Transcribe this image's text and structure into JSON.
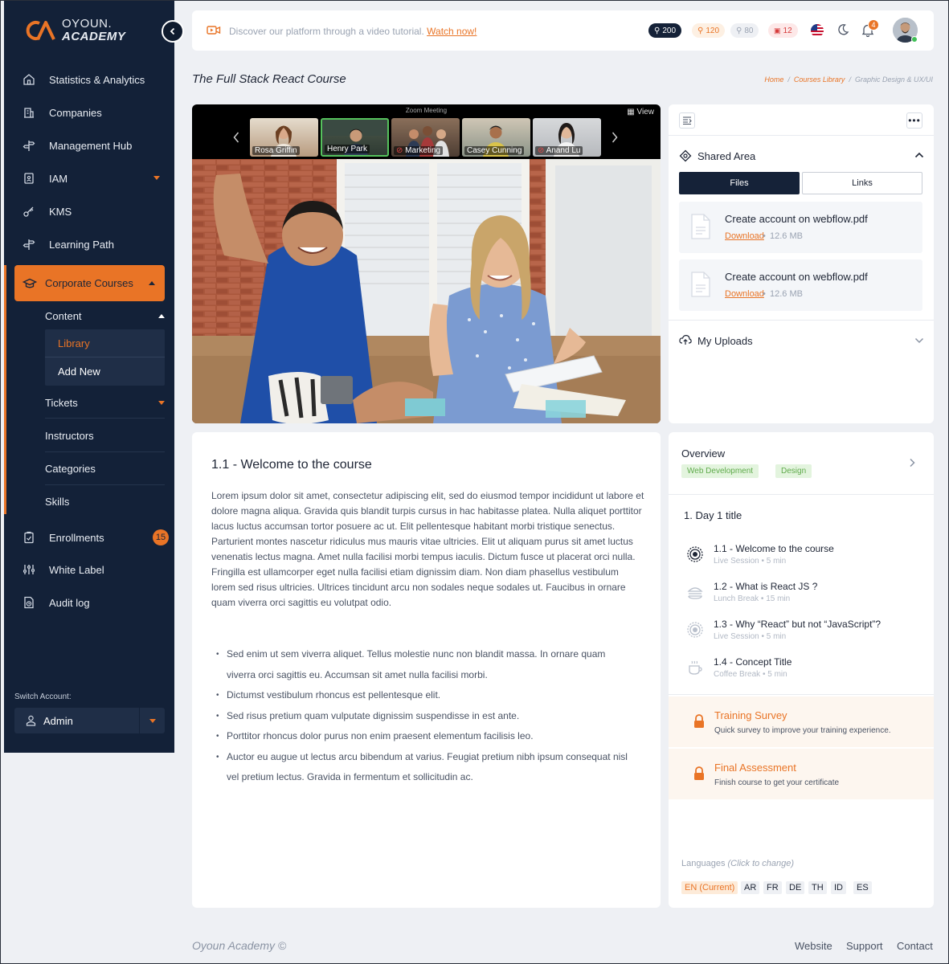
{
  "brand": {
    "line1": "OYOUN.",
    "line2": "ACADEMY"
  },
  "sidebar": {
    "items": [
      {
        "label": "Statistics & Analytics",
        "icon": "home-icon"
      },
      {
        "label": "Companies",
        "icon": "building-icon"
      },
      {
        "label": "Management Hub",
        "icon": "signpost-icon"
      },
      {
        "label": "IAM",
        "icon": "id-badge-icon",
        "has_dropdown": true
      },
      {
        "label": "KMS",
        "icon": "key-icon"
      },
      {
        "label": "Learning Path",
        "icon": "signpost-icon"
      }
    ],
    "active": {
      "label": "Corporate Courses",
      "icon": "graduation-cap-icon"
    },
    "content_group": {
      "label": "Content",
      "children": [
        "Library",
        "Add New"
      ]
    },
    "sub_items": [
      "Tickets",
      "Instructors",
      "Categories",
      "Skills"
    ],
    "bottom_items": [
      {
        "label": "Enrollments",
        "icon": "clipboard-check-icon",
        "badge": "15"
      },
      {
        "label": "White Label",
        "icon": "sliders-icon"
      },
      {
        "label": "Audit log",
        "icon": "file-clock-icon"
      }
    ],
    "switch_label": "Switch Account:",
    "account": "Admin"
  },
  "topbar": {
    "promo_text": "Discover our platform through a video tutorial.",
    "promo_link": "Watch now!",
    "pills": [
      "200",
      "120",
      "80",
      "12"
    ],
    "notification_count": "4"
  },
  "page": {
    "title": "The Full Stack React Course",
    "breadcrumb": [
      "Home",
      "Courses Library",
      "Graphic Design & UX/UI"
    ]
  },
  "video": {
    "meeting_title": "Zoom Meeting",
    "view_label": "View",
    "participants": [
      "Rosa Griffin",
      "Henry Park",
      "Marketing",
      "Casey Cunning",
      "Anand Lu"
    ]
  },
  "shared": {
    "title": "Shared Area",
    "tabs": [
      "Files",
      "Links"
    ],
    "files": [
      {
        "name": "Create account on webflow.pdf",
        "action": "Download",
        "size": "12.6 MB"
      },
      {
        "name": "Create account on webflow.pdf",
        "action": "Download",
        "size": "12.6 MB"
      }
    ],
    "uploads_title": "My Uploads"
  },
  "lesson": {
    "heading": "1.1 - Welcome to the course",
    "paragraph": "Lorem ipsum dolor sit amet, consectetur adipiscing elit, sed do eiusmod tempor incididunt ut labore et dolore magna aliqua. Gravida quis blandit turpis cursus in hac habitasse platea. Nulla aliquet porttitor lacus luctus accumsan tortor posuere ac ut. Elit pellentesque habitant morbi tristique senectus. Parturient montes nascetur ridiculus mus mauris vitae ultricies. Elit ut aliquam purus sit amet luctus venenatis lectus magna. Amet nulla facilisi morbi tempus iaculis. Dictum fusce ut placerat orci nulla. Fringilla est ullamcorper eget nulla facilisi etiam dignissim diam. Non diam phasellus vestibulum lorem sed risus ultricies. Ultrices tincidunt arcu non sodales neque sodales ut. Faucibus in ornare quam viverra orci sagittis eu volutpat odio.",
    "bullets": [
      "Sed enim ut sem viverra aliquet. Tellus molestie nunc non blandit massa. In ornare quam viverra orci sagittis eu. Accumsan sit amet nulla facilisi morbi.",
      "Dictumst vestibulum rhoncus est pellentesque elit.",
      "Sed risus pretium quam vulputate dignissim suspendisse in est ante.",
      "Porttitor rhoncus dolor purus non enim praesent elementum facilisis leo.",
      "Auctor eu augue ut lectus arcu bibendum at varius. Feugiat pretium nibh ipsum consequat nisl vel pretium lectus. Gravida in fermentum et sollicitudin ac."
    ]
  },
  "overview": {
    "title": "Overview",
    "tags": [
      "Web Development",
      "Design"
    ],
    "day_title": "1. Day 1 title",
    "lessons": [
      {
        "title": "1.1 - Welcome to the course",
        "sub": "Live Session • 5 min",
        "icon": "live-session-icon"
      },
      {
        "title": "1.2 - What is React JS ?",
        "sub": "Lunch Break • 15 min",
        "icon": "lunch-icon"
      },
      {
        "title": "1.3 - Why “React” but not “JavaScript”?",
        "sub": "Live Session • 5 min",
        "icon": "live-session-icon"
      },
      {
        "title": "1.4 - Concept Title",
        "sub": "Coffee Break • 5 min",
        "icon": "coffee-cup-icon"
      }
    ],
    "locked": [
      {
        "title": "Training Survey",
        "sub": "Quick survey to improve your training experience."
      },
      {
        "title": "Final Assessment",
        "sub": "Finish course to get your certificate"
      }
    ],
    "languages_label": "Languages",
    "languages_hint": "(Click to change)",
    "languages": [
      "EN (Current)",
      "AR",
      "FR",
      "DE",
      "TH",
      "ID",
      "ES"
    ]
  },
  "footer": {
    "brand": "Oyoun Academy",
    "copyright": "©",
    "links": [
      "Website",
      "Support",
      "Contact"
    ]
  },
  "colors": {
    "accent": "#e97426",
    "sidebar": "#132138",
    "navy": "#152238"
  }
}
